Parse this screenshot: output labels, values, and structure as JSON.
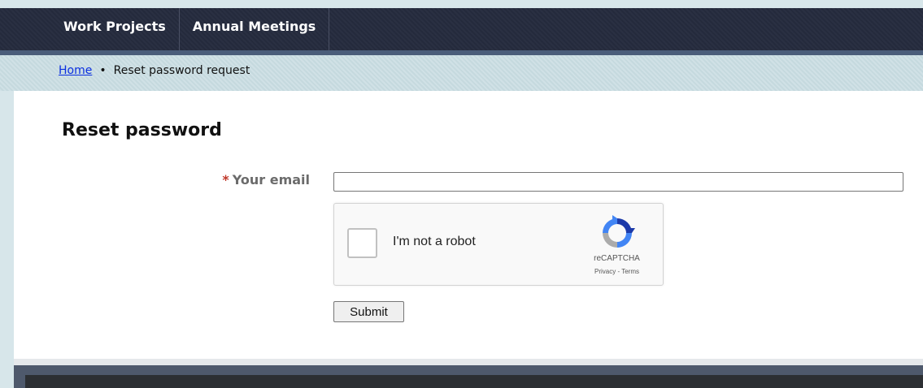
{
  "nav": {
    "items": [
      {
        "label": "Work Projects"
      },
      {
        "label": "Annual Meetings"
      }
    ]
  },
  "breadcrumb": {
    "home_label": "Home",
    "separator": "•",
    "current": "Reset password request"
  },
  "page": {
    "title": "Reset password"
  },
  "form": {
    "required_marker": "*",
    "email_label": "Your email",
    "email_value": "",
    "submit_label": "Submit"
  },
  "captcha": {
    "checkbox_label": "I'm not a robot",
    "brand": "reCAPTCHA",
    "links": "Privacy - Terms"
  },
  "colors": {
    "nav_bg": "#252b3e",
    "breadcrumb_bg": "#c9dde2",
    "link": "#0a2ee0",
    "required": "#c0392b",
    "footer": "#2c2f33"
  }
}
